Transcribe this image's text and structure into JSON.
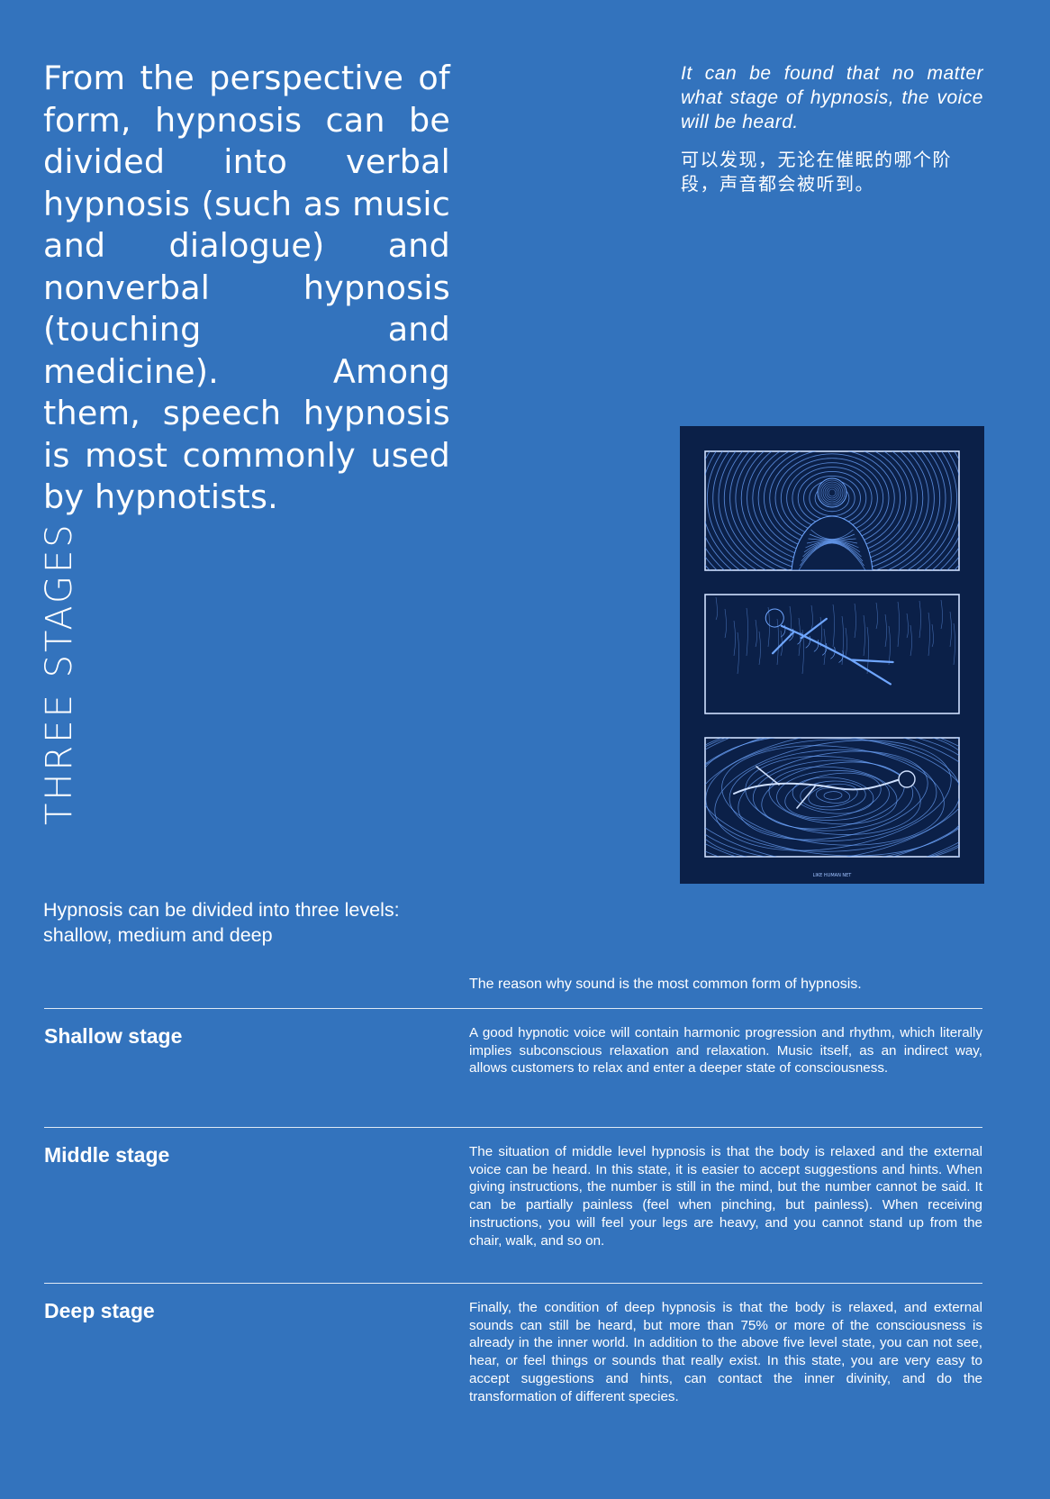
{
  "intro": "From the perspective of form, hypnosis can be di­vided into verbal hypno­sis (such as music and dialogue) and nonverbal hypnosis (touching and medicine). Among them, speech hypnosis is most commonly used by hyp­notists.",
  "quote": {
    "en": "It can be found that no matter what stage of hypnosis, the voice will be heard.",
    "zh": "可以发现，无论在催眠的哪个阶段，声音都会被听到。"
  },
  "section_title": "THREE STAGES",
  "poster": {
    "caption": "LIKE HUMAN NET",
    "background_color": "#0b2048",
    "line_color": "#6fa6ff"
  },
  "levels_caption": "Hypnosis can be divided into three levels: shallow, medium and deep",
  "reason": "The reason why sound is the most common form of hypnosis.",
  "stages": [
    {
      "title": "Shallow stage",
      "text": "A good hypnotic voice will contain harmonic progression and rhythm, which literally implies subconscious relaxation and relaxation. Music itself, as an in­direct way, allows customers to relax and enter a deeper state of conscious­ness."
    },
    {
      "title": "Middle stage",
      "text": "The situation of middle level hypnosis is that the body is relaxed and the ex­ternal voice can be heard. In this state, it is easier to accept suggestions and hints. When giving instructions, the number is still in the mind, but the number cannot be said. It can be partially painless (feel when pinching, but painless). When receiving instructions, you will feel your legs are heavy, and you cannot stand up from the chair, walk, and so on."
    },
    {
      "title": "Deep stage",
      "text": "Finally, the condition of deep hypnosis is that the body is relaxed, and external sounds can still be heard, but more than 75% or more of the consciousness is already in the inner world. In addition to the above five level state, you can not see, hear, or feel things or sounds that really exist. In this state, you are very easy to accept suggestions and hints, can contact the inner divinity, and do the transformation of different species."
    }
  ],
  "colors": {
    "page_background": "#3373bd",
    "text": "#ffffff"
  }
}
